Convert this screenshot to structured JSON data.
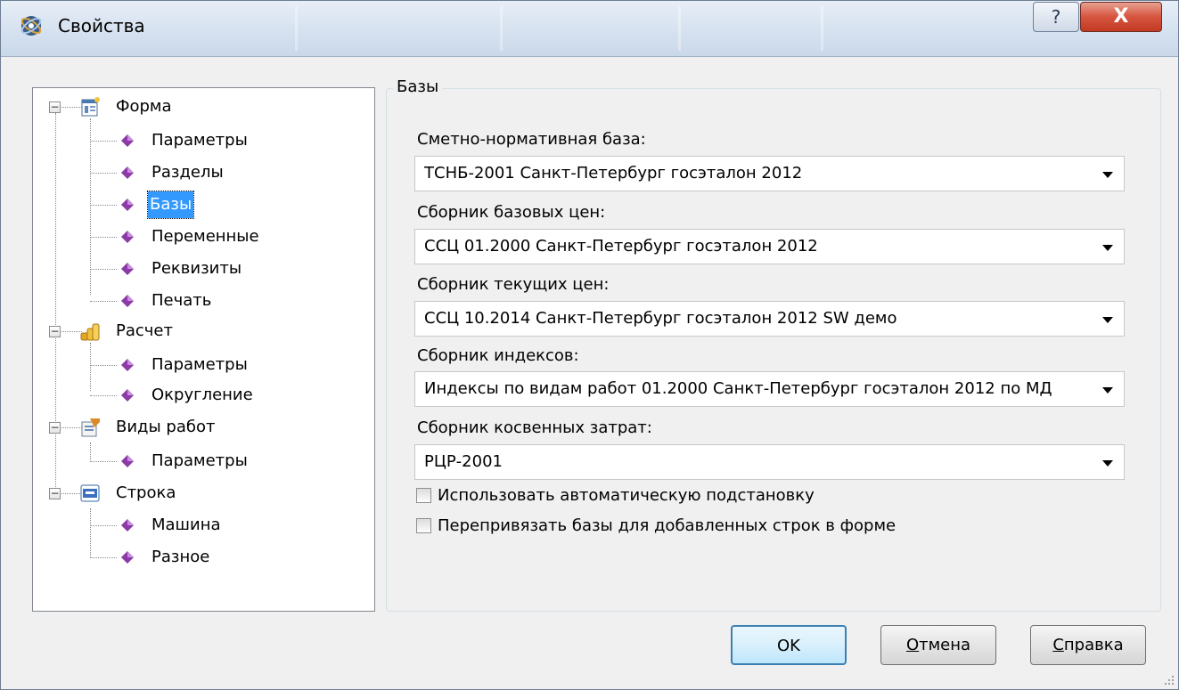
{
  "window": {
    "title": "Свойства",
    "help_glyph": "?",
    "close_glyph": "X"
  },
  "tree": {
    "nodes": [
      {
        "label": "Форма",
        "icon": "form-icon",
        "children": [
          "Параметры",
          "Разделы",
          "Базы",
          "Переменные",
          "Реквизиты",
          "Печать"
        ]
      },
      {
        "label": "Расчет",
        "icon": "coins-icon",
        "children": [
          "Параметры",
          "Округление"
        ]
      },
      {
        "label": "Виды работ",
        "icon": "work-types-icon",
        "children": [
          "Параметры"
        ]
      },
      {
        "label": "Строка",
        "icon": "row-icon",
        "children": [
          "Машина",
          "Разное"
        ]
      }
    ],
    "selected": "Базы",
    "expander_glyph": "−"
  },
  "bases": {
    "group_title": "Базы",
    "fields": [
      {
        "label": "Сметно-нормативная база:",
        "value": "ТСНБ-2001 Санкт-Петербург госэталон 2012"
      },
      {
        "label": "Сборник базовых цен:",
        "value": "ССЦ 01.2000 Санкт-Петербург госэталон 2012"
      },
      {
        "label": "Сборник текущих цен:",
        "value": "ССЦ 10.2014 Санкт-Петербург госэталон 2012 SW демо"
      },
      {
        "label": "Сборник индексов:",
        "value": "Индексы по видам работ 01.2000 Санкт-Петербург госэталон 2012 по МД"
      },
      {
        "label": "Сборник косвенных затрат:",
        "value": "РЦР-2001"
      }
    ],
    "checkboxes": [
      {
        "label": "Использовать автоматическую подстановку",
        "checked": false
      },
      {
        "label": "Перепривязать базы для добавленных строк в форме",
        "checked": false
      }
    ]
  },
  "buttons": {
    "ok": "OK",
    "cancel_first": "О",
    "cancel_rest": "тмена",
    "help_first": "С",
    "help_rest": "правка"
  },
  "colors": {
    "selection": "#3399ff",
    "gem": "#8b3aa6",
    "close_button": "#c94c35"
  }
}
